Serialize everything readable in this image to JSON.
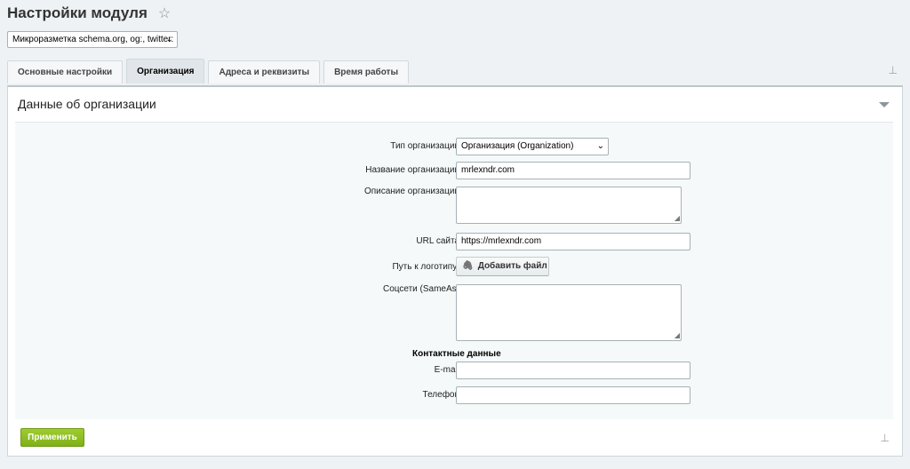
{
  "page": {
    "title": "Настройки модуля",
    "favorite_icon": "star-icon"
  },
  "module_select": {
    "value": "Микроразметка schema.org, og:, twitter:"
  },
  "tabs": [
    {
      "label": "Основные настройки",
      "active": false
    },
    {
      "label": "Организация",
      "active": true
    },
    {
      "label": "Адреса и реквизиты",
      "active": false
    },
    {
      "label": "Время работы",
      "active": false
    }
  ],
  "section": {
    "title": "Данные об организации"
  },
  "form": {
    "org_type": {
      "label": "Тип организации",
      "value": "Организация (Organization)"
    },
    "org_name": {
      "label": "Название организации",
      "value": "mrlexndr.com"
    },
    "org_description": {
      "label": "Описание организации",
      "value": ""
    },
    "site_url": {
      "label": "URL сайта",
      "value": "https://mrlexndr.com"
    },
    "logo_path": {
      "label": "Путь к логотипу:",
      "button": "Добавить файл"
    },
    "social": {
      "label": "Соцсети (SameAs)",
      "value": ""
    },
    "contacts_heading": "Контактные данные",
    "email": {
      "label": "E-mail",
      "value": ""
    },
    "phone": {
      "label": "Телефон",
      "value": ""
    }
  },
  "footer": {
    "apply_label": "Применить"
  },
  "colors": {
    "apply_green": "#8bbd1f",
    "panel_bg": "#f5f9f9",
    "page_bg": "#eef2f4"
  }
}
